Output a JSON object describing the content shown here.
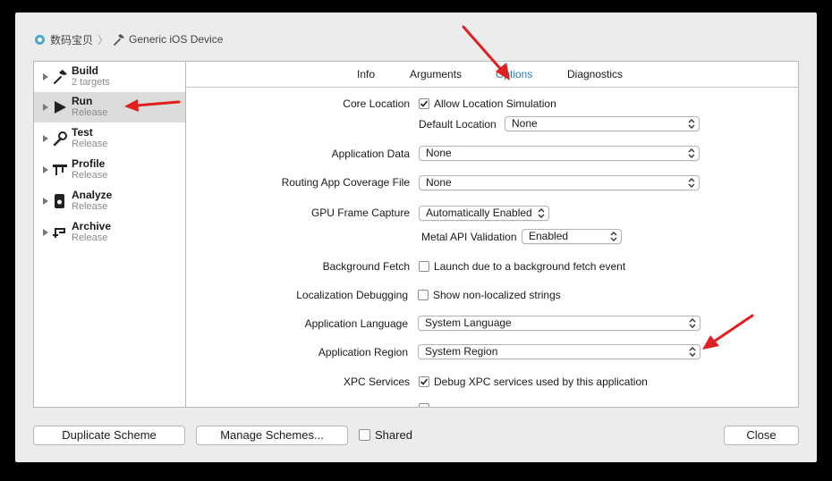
{
  "header": {
    "scheme_name": "数码宝贝",
    "destination": "Generic iOS Device"
  },
  "sidebar": {
    "items": [
      {
        "title": "Build",
        "subtitle": "2 targets",
        "icon": "hammer-icon"
      },
      {
        "title": "Run",
        "subtitle": "Release",
        "icon": "play-icon"
      },
      {
        "title": "Test",
        "subtitle": "Release",
        "icon": "wrench-icon"
      },
      {
        "title": "Profile",
        "subtitle": "Release",
        "icon": "calipers-icon"
      },
      {
        "title": "Analyze",
        "subtitle": "Release",
        "icon": "analyze-icon"
      },
      {
        "title": "Archive",
        "subtitle": "Release",
        "icon": "archive-icon"
      }
    ],
    "selected": "Run"
  },
  "tabs": {
    "items": [
      "Info",
      "Arguments",
      "Options",
      "Diagnostics"
    ],
    "active": "Options"
  },
  "options": {
    "core_location_label": "Core Location",
    "allow_location_label": "Allow Location Simulation",
    "allow_location_checked": true,
    "default_location_label": "Default Location",
    "default_location_value": "None",
    "app_data_label": "Application Data",
    "app_data_value": "None",
    "routing_label": "Routing App Coverage File",
    "routing_value": "None",
    "gpu_label": "GPU Frame Capture",
    "gpu_value": "Automatically Enabled",
    "metal_label": "Metal API Validation",
    "metal_value": "Enabled",
    "bg_fetch_label": "Background Fetch",
    "bg_fetch_option": "Launch due to a background fetch event",
    "bg_fetch_checked": false,
    "loc_debug_label": "Localization Debugging",
    "loc_debug_option": "Show non-localized strings",
    "loc_debug_checked": false,
    "app_lang_label": "Application Language",
    "app_lang_value": "System Language",
    "app_region_label": "Application Region",
    "app_region_value": "System Region",
    "xpc_label": "XPC Services",
    "xpc_option": "Debug XPC services used by this application",
    "xpc_checked": true
  },
  "footer": {
    "duplicate_label": "Duplicate Scheme",
    "manage_label": "Manage Schemes...",
    "shared_label": "Shared",
    "shared_checked": false,
    "close_label": "Close"
  },
  "colors": {
    "accent": "#2a7bd6",
    "annotation_arrow": "#e02020",
    "selected_row": "#dcdcdc"
  }
}
